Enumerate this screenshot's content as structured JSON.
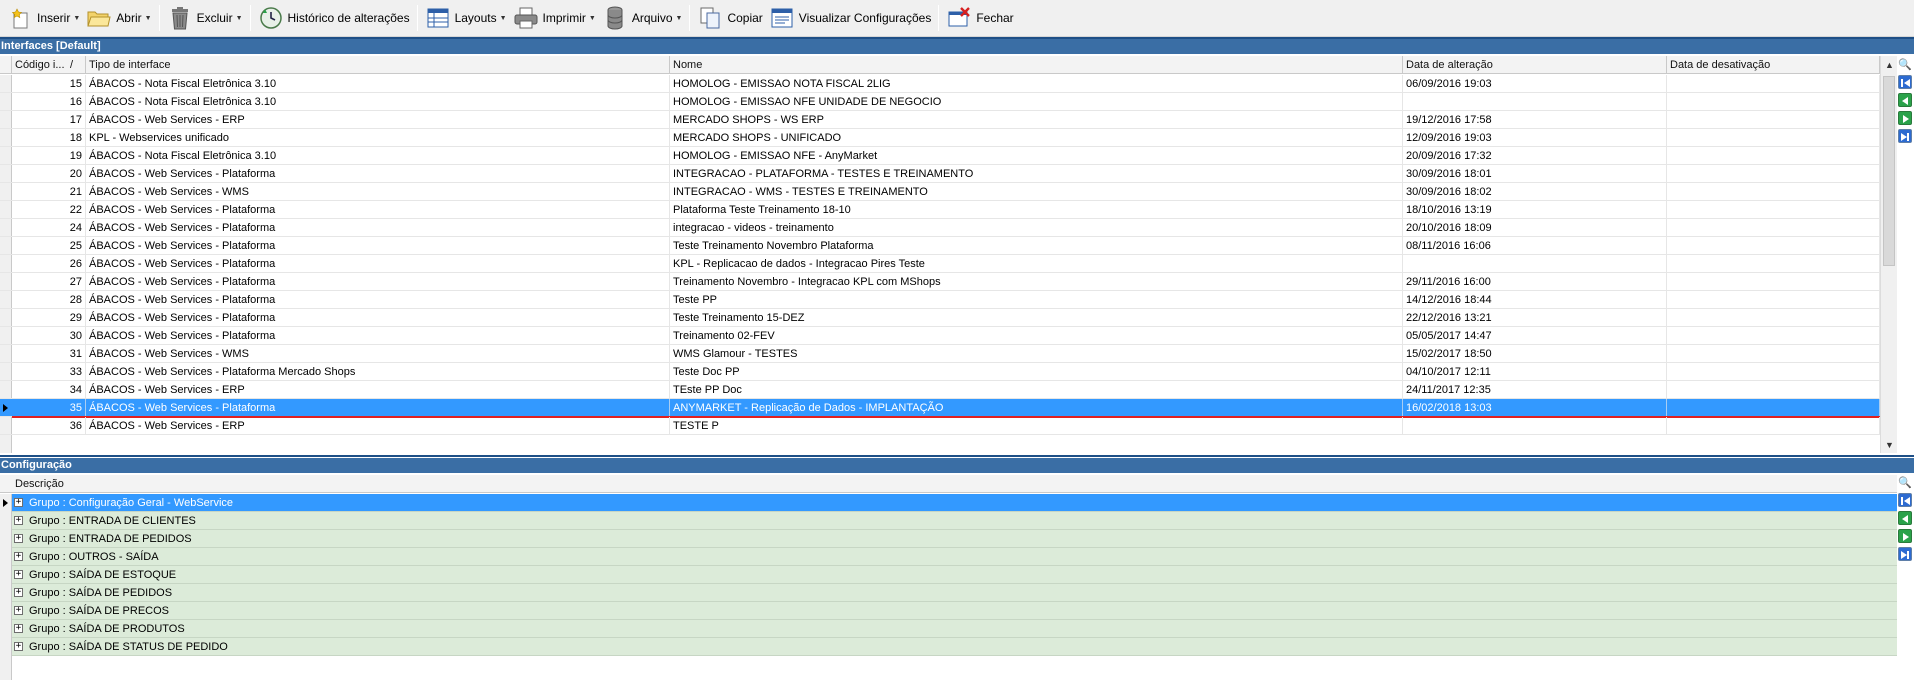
{
  "toolbar": {
    "inserir": "Inserir",
    "abrir": "Abrir",
    "excluir": "Excluir",
    "historico": "Histórico de alterações",
    "layouts": "Layouts",
    "imprimir": "Imprimir",
    "arquivo": "Arquivo",
    "copiar": "Copiar",
    "visualizar": "Visualizar Configurações",
    "fechar": "Fechar"
  },
  "interfaces": {
    "title": "Interfaces [Default]",
    "columns": {
      "codigo": "Código i...",
      "sort": "/",
      "tipo": "Tipo de interface",
      "nome": "Nome",
      "data_alt": "Data de alteração",
      "data_des": "Data de desativação"
    },
    "rows": [
      {
        "codigo": "15",
        "tipo": "ÁBACOS - Nota Fiscal Eletrônica 3.10",
        "nome": "HOMOLOG - EMISSAO NOTA FISCAL 2LIG",
        "data_alt": "06/09/2016 19:03",
        "data_des": ""
      },
      {
        "codigo": "16",
        "tipo": "ÁBACOS - Nota Fiscal Eletrônica 3.10",
        "nome": "HOMOLOG - EMISSAO NFE UNIDADE DE NEGOCIO",
        "data_alt": "",
        "data_des": ""
      },
      {
        "codigo": "17",
        "tipo": "ÁBACOS - Web Services - ERP",
        "nome": "MERCADO SHOPS - WS ERP",
        "data_alt": "19/12/2016 17:58",
        "data_des": ""
      },
      {
        "codigo": "18",
        "tipo": "KPL - Webservices unificado",
        "nome": "MERCADO SHOPS - UNIFICADO",
        "data_alt": "12/09/2016 19:03",
        "data_des": ""
      },
      {
        "codigo": "19",
        "tipo": "ÁBACOS - Nota Fiscal Eletrônica 3.10",
        "nome": "HOMOLOG - EMISSAO NFE - AnyMarket",
        "data_alt": "20/09/2016 17:32",
        "data_des": ""
      },
      {
        "codigo": "20",
        "tipo": "ÁBACOS - Web Services - Plataforma",
        "nome": "INTEGRACAO - PLATAFORMA - TESTES E TREINAMENTO",
        "data_alt": "30/09/2016 18:01",
        "data_des": ""
      },
      {
        "codigo": "21",
        "tipo": "ÁBACOS - Web Services - WMS",
        "nome": "INTEGRACAO - WMS - TESTES E TREINAMENTO",
        "data_alt": "30/09/2016 18:02",
        "data_des": ""
      },
      {
        "codigo": "22",
        "tipo": "ÁBACOS - Web Services - Plataforma",
        "nome": "Plataforma Teste Treinamento 18-10",
        "data_alt": "18/10/2016 13:19",
        "data_des": ""
      },
      {
        "codigo": "24",
        "tipo": "ÁBACOS - Web Services - Plataforma",
        "nome": "integracao - videos - treinamento",
        "data_alt": "20/10/2016 18:09",
        "data_des": ""
      },
      {
        "codigo": "25",
        "tipo": "ÁBACOS - Web Services - Plataforma",
        "nome": "Teste Treinamento Novembro Plataforma",
        "data_alt": "08/11/2016 16:06",
        "data_des": ""
      },
      {
        "codigo": "26",
        "tipo": "ÁBACOS - Web Services - Plataforma",
        "nome": "KPL - Replicacao de dados - Integracao Pires Teste",
        "data_alt": "",
        "data_des": ""
      },
      {
        "codigo": "27",
        "tipo": "ÁBACOS - Web Services - Plataforma",
        "nome": "Treinamento Novembro - Integracao KPL com MShops",
        "data_alt": "29/11/2016 16:00",
        "data_des": ""
      },
      {
        "codigo": "28",
        "tipo": "ÁBACOS - Web Services - Plataforma",
        "nome": "Teste PP",
        "data_alt": "14/12/2016 18:44",
        "data_des": ""
      },
      {
        "codigo": "29",
        "tipo": "ÁBACOS - Web Services - Plataforma",
        "nome": "Teste Treinamento 15-DEZ",
        "data_alt": "22/12/2016 13:21",
        "data_des": ""
      },
      {
        "codigo": "30",
        "tipo": "ÁBACOS - Web Services - Plataforma",
        "nome": "Treinamento 02-FEV",
        "data_alt": "05/05/2017 14:47",
        "data_des": ""
      },
      {
        "codigo": "31",
        "tipo": "ÁBACOS - Web Services - WMS",
        "nome": "WMS Glamour - TESTES",
        "data_alt": "15/02/2017 18:50",
        "data_des": ""
      },
      {
        "codigo": "33",
        "tipo": "ÁBACOS - Web Services - Plataforma Mercado Shops",
        "nome": "Teste Doc PP",
        "data_alt": "04/10/2017 12:11",
        "data_des": ""
      },
      {
        "codigo": "34",
        "tipo": "ÁBACOS - Web Services - ERP",
        "nome": "TEste PP Doc",
        "data_alt": "24/11/2017 12:35",
        "data_des": ""
      },
      {
        "codigo": "35",
        "tipo": "ÁBACOS - Web Services - Plataforma",
        "nome": "ANYMARKET - Replicação de Dados - IMPLANTAÇÃO",
        "data_alt": "16/02/2018 13:03",
        "data_des": ""
      },
      {
        "codigo": "36",
        "tipo": "ÁBACOS - Web Services - ERP",
        "nome": "TESTE P",
        "data_alt": "",
        "data_des": ""
      }
    ]
  },
  "configuracao": {
    "title": "Configuração",
    "column": "Descrição",
    "groups": [
      "Grupo : Configuração Geral - WebService",
      "Grupo : ENTRADA DE CLIENTES",
      "Grupo : ENTRADA DE PEDIDOS",
      "Grupo : OUTROS - SAÍDA",
      "Grupo : SAÍDA DE ESTOQUE",
      "Grupo : SAÍDA DE PEDIDOS",
      "Grupo : SAÍDA DE PRECOS",
      "Grupo : SAÍDA DE PRODUTOS",
      "Grupo : SAÍDA DE STATUS DE PEDIDO"
    ]
  },
  "colors": {
    "panel_header": "#3a6ea5",
    "selection": "#3399ff",
    "group_row": "#dcebd9",
    "selection_rule": "#e02020"
  }
}
